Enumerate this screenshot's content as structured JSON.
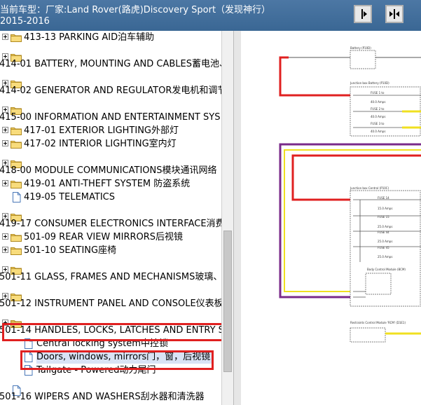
{
  "window": {
    "title": "当前车型：厂家:Land Rover(路虎)Discovery Sport（发现神行）2015-2016"
  },
  "toolbar": {
    "btn1_icon": "expand-arrows-icon",
    "btn2_icon": "collapse-arrows-icon"
  },
  "tree": {
    "items": [
      {
        "label": "413-13 PARKING AID泊车辅助"
      },
      {
        "label": "414-01 BATTERY, MOUNTING AND CABLES蓄电池、"
      },
      {
        "label": "414-02 GENERATOR AND REGULATOR发电机和调节"
      },
      {
        "label": "415-00 INFORMATION AND ENTERTAINMENT SYS"
      },
      {
        "label": "417-01 EXTERIOR LIGHTING外部灯"
      },
      {
        "label": "417-02 INTERIOR LIGHTING室内灯"
      },
      {
        "label": "418-00 MODULE COMMUNICATIONS模块通讯网络"
      },
      {
        "label": "419-01 ANTI-THEFT SYSTEM 防盗系统"
      },
      {
        "label": "419-05 TELEMATICS"
      },
      {
        "label": "419-17 CONSUMER ELECTRONICS INTERFACE消费"
      },
      {
        "label": "501-09 REAR VIEW MIRRORS后视镜"
      },
      {
        "label": "501-10 SEATING座椅"
      },
      {
        "label": "501-11 GLASS, FRAMES AND MECHANISMS玻璃、"
      },
      {
        "label": "501-12 INSTRUMENT PANEL AND CONSOLE仪表板"
      },
      {
        "label": "501-14 HANDLES, LOCKS, LATCHES AND ENTRY S"
      },
      {
        "label": "Central locking system中控锁"
      },
      {
        "label": "Doors, windows, mirrors门，窗，后视镜"
      },
      {
        "label": "Tailgate - Powered动力尾门"
      },
      {
        "label": "501-16 WIPERS AND WASHERS刮水器和清洗器"
      }
    ]
  },
  "diagram": {
    "labels": [
      "Battery (P10D)",
      "Junction box Battery (P10D)",
      "FUSE 1 to",
      "40.0 Amps",
      "FUSE 2 to",
      "40.0 Amps",
      "FUSE 3 to",
      "40.0 Amps",
      "Junction box Central (P10C)",
      "FUSE 14",
      "15.0 Amps",
      "FUSE 15",
      "25.0 Amps",
      "FUSE 44",
      "25.0 Amps",
      "FUSE 45",
      "25.0 Amps",
      "Body Control Module (BCM)",
      "Restraints Control Module 'RCM' (D1E1)"
    ]
  },
  "colors": {
    "titlebar": "#3f6b98",
    "highlight_box": "#e02020",
    "selection": "#d9e3f5",
    "wire_red": "#e02020",
    "wire_purple": "#7a2a8a",
    "wire_yellow": "#f0e020"
  }
}
